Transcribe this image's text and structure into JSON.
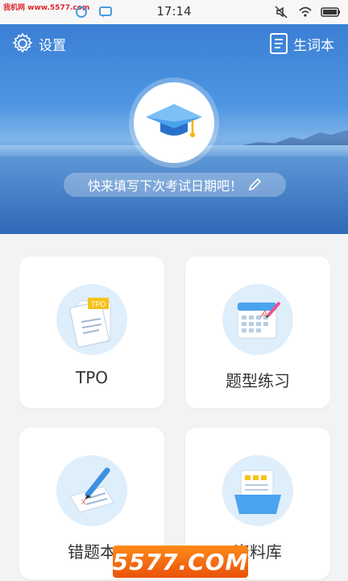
{
  "status_bar": {
    "watermark": "我机网 www.5577.com",
    "time": "17:14"
  },
  "header": {
    "settings_label": "设置",
    "vocab_label": "生词本"
  },
  "hero": {
    "exam_prompt": "快来填写下次考试日期吧！"
  },
  "cards": [
    {
      "label": "TPO",
      "icon_tag": "TPO"
    },
    {
      "label": "题型练习",
      "icon_tag": "A"
    },
    {
      "label": "错题本",
      "icon_tag": "x"
    },
    {
      "label": "资料库"
    }
  ],
  "watermark": "5577.COM",
  "colors": {
    "accent": "#3a7fd4",
    "card_icon_bg": "#dfeefb",
    "page_bg": "#f2f3f5"
  }
}
